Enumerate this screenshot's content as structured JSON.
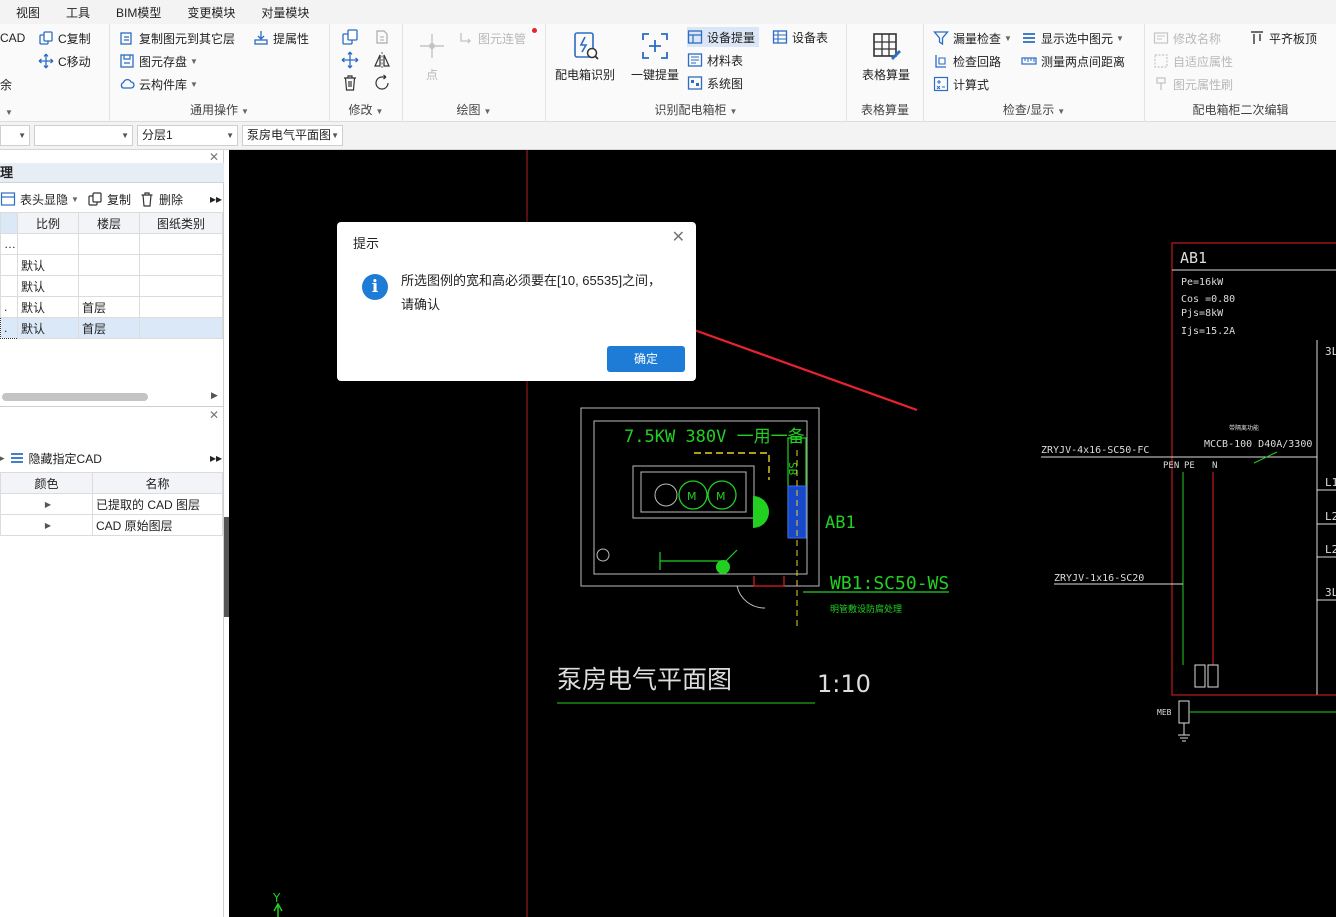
{
  "menubar": [
    "视图",
    "工具",
    "BIM模型",
    "变更模块",
    "对量模块"
  ],
  "ribbon": {
    "group0": {
      "cad_label": "CAD",
      "copy_label": "C复制",
      "move_label": "C移动",
      "frag_label": "余"
    },
    "common": {
      "label": "通用操作",
      "copy_to_layer": "复制图元到其它层",
      "extract_props": "提属性",
      "save_elements": "图元存盘",
      "cloud_lib": "云构件库"
    },
    "modify": {
      "label": "修改"
    },
    "draw": {
      "label": "绘图",
      "point": "点",
      "connect": "图元连管"
    },
    "identify": {
      "label": "识别配电箱柜",
      "box_identify": "配电箱识别",
      "one_click": "一键提量",
      "equip_extract": "设备提量",
      "equip_table": "设备表",
      "material_table": "材料表",
      "system_diagram": "系统图"
    },
    "table_calc": {
      "label": "表格算量",
      "btn": "表格算量"
    },
    "check": {
      "label": "检查/显示",
      "missing_check": "漏量检查",
      "show_selected": "显示选中图元",
      "check_loop": "检查回路",
      "measure": "测量两点间距离",
      "formula": "计算式"
    },
    "secondary": {
      "label": "配电箱柜二次编辑",
      "rename": "修改名称",
      "adaptive": "自适应属性",
      "brush": "图元属性刷",
      "align": "平齐板顶"
    }
  },
  "combobar": {
    "layer": "分层1",
    "drawing": "泵房电气平面图"
  },
  "drawing_panel": {
    "title": "理",
    "toolbar": {
      "header_toggle": "表头显隐",
      "copy": "复制",
      "delete": "删除"
    },
    "columns": [
      "比例",
      "楼层",
      "图纸类别"
    ],
    "rows": [
      {
        "lead": "…",
        "scale": "",
        "floor": "",
        "type": ""
      },
      {
        "lead": "",
        "scale": "默认",
        "floor": "",
        "type": ""
      },
      {
        "lead": "",
        "scale": "默认",
        "floor": "",
        "type": ""
      },
      {
        "lead": ".",
        "scale": "默认",
        "floor": "首层",
        "type": ""
      },
      {
        "lead": ".",
        "scale": "默认",
        "floor": "首层",
        "type": ""
      }
    ]
  },
  "layer_panel": {
    "toolbar": {
      "hide_cad": "隐藏指定CAD"
    },
    "columns": [
      "颜色",
      "名称"
    ],
    "rows": [
      {
        "name": "已提取的 CAD 图层"
      },
      {
        "name": "CAD 原始图层"
      }
    ]
  },
  "cad": {
    "box_rating": "7.5KW  380V  一用一备",
    "box_name": "AB1",
    "sb_label": "SB",
    "circuit": "WB1:SC50-WS",
    "circuit_note": "明管敷设防腐处理",
    "plan_title": "泵房电气平面图",
    "plan_scale": "1:10",
    "sys_title": "AB1",
    "sys_params": [
      "Pe=16kW",
      "Cos =0.80",
      "Pjs=8kW",
      "Ijs=15.2A"
    ],
    "incoming_cable": "ZRYJV-4x16-SC50-FC",
    "breaker_note": "带隔离功能",
    "breaker": "MCCB-100  D40A/3300",
    "pen": "PEN",
    "pe": "PE",
    "n": "N",
    "ground_cable": "ZRYJV-1x16-SC20",
    "meb": "MEB",
    "right_labels": [
      "3L",
      "L1",
      "L2",
      "L2",
      "3L"
    ],
    "axis_y": "Y",
    "tag": "AB1"
  },
  "dialog": {
    "title": "提示",
    "message": "所选图例的宽和高必须要在[10, 65535]之间，请确认",
    "ok": "确定"
  },
  "colors": {
    "accent": "#1e7cd6",
    "cad_green": "#22d022",
    "cad_yellow": "#e6d21e",
    "cad_red": "#e02020",
    "arrow_red": "#e8232f"
  }
}
